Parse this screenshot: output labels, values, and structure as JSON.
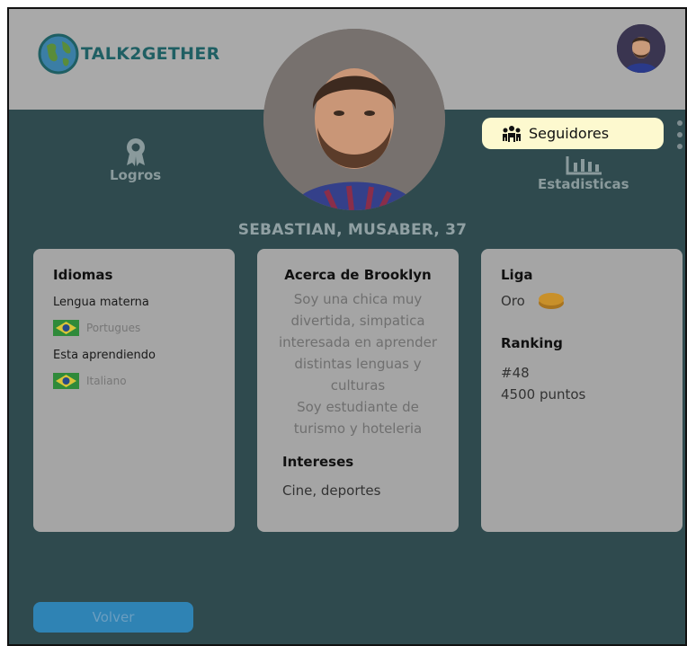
{
  "header": {
    "brand": "TALK2GETHER"
  },
  "profile": {
    "name": "SEBASTIAN, MUSABER, 37"
  },
  "actions": {
    "logros_label": "Logros",
    "estadisticas_label": "Estadisticas"
  },
  "tooltip": {
    "label": "Seguidores"
  },
  "languages": {
    "title": "Idiomas",
    "native_label": "Lengua materna",
    "native_language": "Portugues",
    "learning_label": "Esta aprendiendo",
    "learning_language": "Italiano"
  },
  "about": {
    "title": "Acerca de Brooklyn",
    "line1": "Soy una chica muy",
    "line2": "divertida, simpatica",
    "line3": "interesada en aprender",
    "line4": "distintas lenguas y",
    "line5": "culturas",
    "line6": "Soy estudiante de",
    "line7": "turismo y hoteleria",
    "interests_title": "Intereses",
    "interests": "Cine, deportes"
  },
  "league": {
    "title": "Liga",
    "value": "Oro",
    "ranking_title": "Ranking",
    "rank": "#48",
    "points": "4500 puntos"
  },
  "buttons": {
    "back": "Volver"
  },
  "colors": {
    "overlay_teal": "#2f4a4e",
    "header_gray": "#a9a9a9",
    "card_gray": "#a5a5a5",
    "tooltip_bg": "#fdf9cf",
    "button_blue": "#2f83b4",
    "coin_gold": "#c8902a"
  },
  "icons": {
    "brand": "globe-icon",
    "logros": "award-ribbon-icon",
    "estadisticas": "bar-chart-icon",
    "tooltip": "followers-group-icon",
    "menu": "kebab-menu-icon",
    "flag": "brazil-flag-icon",
    "league": "gold-coin-icon"
  }
}
